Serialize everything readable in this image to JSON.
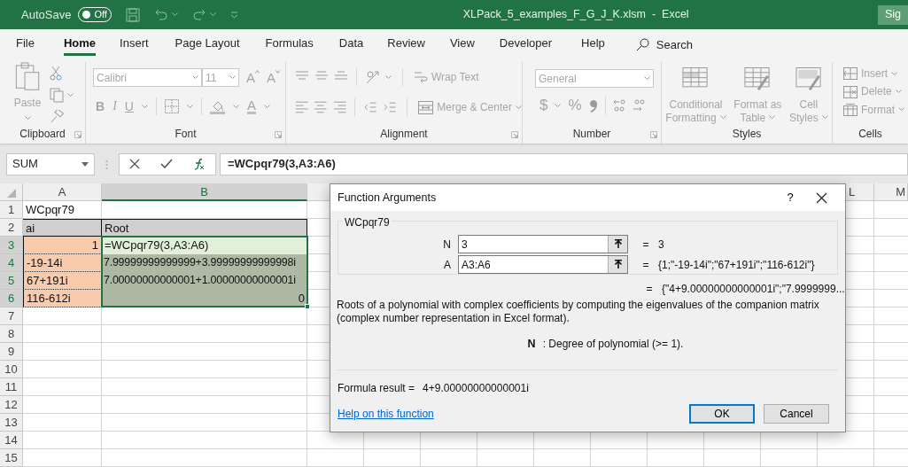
{
  "title_bar": {
    "autosave_label": "AutoSave",
    "autosave": {
      "on": false,
      "label": "Off"
    },
    "title": "XLPack_5_examples_F_G_J_K.xlsm  -  Excel",
    "account_button": "Sig"
  },
  "menu_tabs": [
    {
      "label": "File",
      "selected": false
    },
    {
      "label": "Home",
      "selected": true
    },
    {
      "label": "Insert",
      "selected": false
    },
    {
      "label": "Page Layout",
      "selected": false
    },
    {
      "label": "Formulas",
      "selected": false
    },
    {
      "label": "Data",
      "selected": false
    },
    {
      "label": "Review",
      "selected": false
    },
    {
      "label": "View",
      "selected": false
    },
    {
      "label": "Developer",
      "selected": false
    },
    {
      "label": "Help",
      "selected": false
    }
  ],
  "search": {
    "label": "Search"
  },
  "ribbon": {
    "disabled": true,
    "clipboard": {
      "paste": "Paste",
      "label": "Clipboard"
    },
    "font": {
      "font_name": "Calibri",
      "font_size": "11",
      "grow": "A",
      "shrink": "A",
      "bold": "B",
      "italic": "I",
      "underline": "U",
      "font_color": "A",
      "label": "Font"
    },
    "alignment": {
      "wrap_text": "Wrap Text",
      "merge": "Merge & Center",
      "label": "Alignment"
    },
    "number": {
      "format": "General",
      "currency": "$",
      "percent": "%",
      "label": "Number"
    },
    "styles": {
      "buttons": [
        {
          "lines": [
            "Conditional",
            "Formatting"
          ]
        },
        {
          "lines": [
            "Format as",
            "Table"
          ]
        },
        {
          "lines": [
            "Cell",
            "Styles"
          ]
        }
      ],
      "label": "Styles"
    },
    "cells": {
      "buttons": [
        "Insert",
        "Delete",
        "Format"
      ],
      "label": "Cells"
    }
  },
  "formula_bar": {
    "name_box": "SUM",
    "formula": "=WCpqr79(3,A3:A6)"
  },
  "sheet": {
    "columns": [
      {
        "label": "A",
        "selected": false
      },
      {
        "label": "B",
        "selected": true
      },
      {
        "label": "L",
        "selected": false
      },
      {
        "label": "M",
        "selected": false
      }
    ],
    "rows": [
      {
        "number": "1",
        "selected": false,
        "cells": [
          {
            "kind": "text",
            "text": "WCpqr79"
          }
        ]
      },
      {
        "number": "2",
        "selected": false,
        "cells": [
          {
            "kind": "header",
            "text": "ai"
          },
          {
            "kind": "header",
            "text": "Root"
          }
        ]
      },
      {
        "number": "3",
        "selected": true,
        "cells": [
          {
            "kind": "input-number",
            "text": "1"
          },
          {
            "kind": "editing",
            "text": "=WCpqr79(3,A3:A6)"
          }
        ]
      },
      {
        "number": "4",
        "selected": true,
        "cells": [
          {
            "kind": "input-text",
            "text": "-19-14i"
          },
          {
            "kind": "result-text",
            "text": "7.99999999999999+3.99999999999998i"
          }
        ]
      },
      {
        "number": "5",
        "selected": true,
        "cells": [
          {
            "kind": "input-text",
            "text": "67+191i"
          },
          {
            "kind": "result-text",
            "text": "7.00000000000001+1.00000000000001i"
          }
        ]
      },
      {
        "number": "6",
        "selected": true,
        "cells": [
          {
            "kind": "input-text",
            "text": "116-612i"
          },
          {
            "kind": "result-number",
            "text": "0"
          }
        ]
      },
      {
        "number": "7",
        "selected": false
      },
      {
        "number": "8",
        "selected": false
      },
      {
        "number": "9",
        "selected": false
      },
      {
        "number": "10",
        "selected": false
      },
      {
        "number": "11",
        "selected": false
      },
      {
        "number": "12",
        "selected": false
      },
      {
        "number": "13",
        "selected": false
      },
      {
        "number": "14",
        "selected": false
      },
      {
        "number": "15",
        "selected": false
      }
    ]
  },
  "dialog": {
    "title": "Function Arguments",
    "help": "?",
    "function_name": "WCpqr79",
    "arguments": [
      {
        "name": "N",
        "value": "3",
        "equals": "=",
        "result": "3"
      },
      {
        "name": "A",
        "value": "A3:A6",
        "equals": "=",
        "result": "{1;\"-19-14i\";\"67+191i\";\"116-612i\"}"
      }
    ],
    "result_preview": {
      "equals": "=",
      "value": "{\"4+9.00000000000001i\";\"7.9999999..."
    },
    "description": "Roots of a polynomial with complex coefficients by computing the eigenvalues of the companion matrix (complex number representation in Excel format).",
    "argument_help": {
      "name": "N",
      "text": ": Degree of polynomial (>= 1)."
    },
    "formula_result": {
      "label": "Formula result =",
      "value": "4+9.00000000000001i"
    },
    "help_link": "Help on this function",
    "buttons": [
      {
        "label": "OK",
        "default": true
      },
      {
        "label": "Cancel",
        "default": false
      }
    ]
  }
}
